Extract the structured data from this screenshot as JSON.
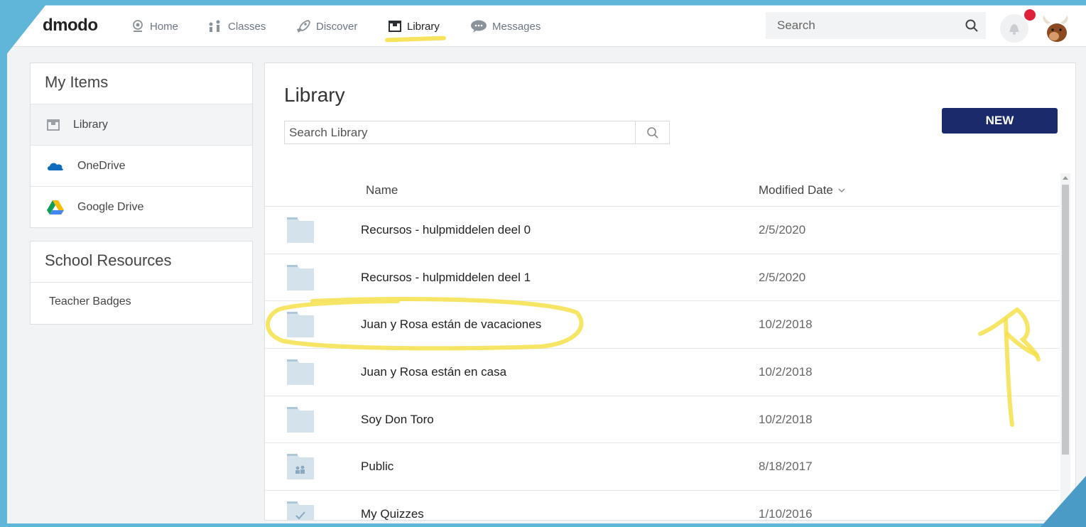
{
  "app": {
    "logo_text": "dmodo"
  },
  "nav": {
    "home": "Home",
    "classes": "Classes",
    "discover": "Discover",
    "library": "Library",
    "messages": "Messages"
  },
  "search": {
    "placeholder": "Search"
  },
  "sidebar": {
    "my_items_title": "My Items",
    "items": [
      "Library",
      "OneDrive",
      "Google Drive"
    ],
    "school_resources_title": "School Resources",
    "resources": [
      "Teacher Badges"
    ]
  },
  "library": {
    "title": "Library",
    "search_placeholder": "Search Library",
    "new_button": "NEW",
    "columns": {
      "name": "Name",
      "modified": "Modified Date"
    },
    "rows": [
      {
        "name": "Recursos - hulpmiddelen deel 0",
        "date": "2/5/2020",
        "icon": "folder-icon"
      },
      {
        "name": "Recursos - hulpmiddelen deel 1",
        "date": "2/5/2020",
        "icon": "folder-icon"
      },
      {
        "name": "Juan y Rosa están de vacaciones",
        "date": "10/2/2018",
        "icon": "folder-icon"
      },
      {
        "name": "Juan y Rosa están en casa",
        "date": "10/2/2018",
        "icon": "folder-icon"
      },
      {
        "name": "Soy Don Toro",
        "date": "10/2/2018",
        "icon": "folder-icon"
      },
      {
        "name": "Public",
        "date": "8/18/2017",
        "icon": "shared-folder-icon"
      },
      {
        "name": "My Quizzes",
        "date": "1/10/2016",
        "icon": "quiz-folder-icon"
      }
    ]
  },
  "colors": {
    "accent_button": "#1b2a6b",
    "highlight": "#f6e04a",
    "frame": "#5fb6d9",
    "notification_badge": "#e0213a"
  }
}
